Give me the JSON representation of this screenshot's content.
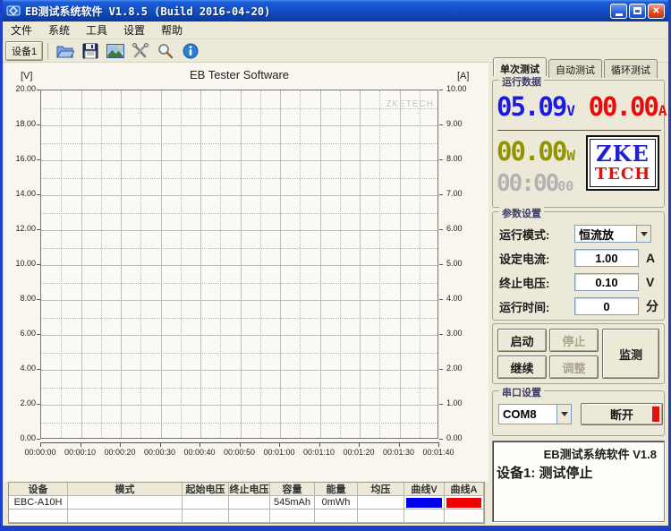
{
  "window": {
    "title": "EB测试系统软件 V1.8.5 (Build 2016-04-20)",
    "icons": [
      "app-icon",
      "minimize-button",
      "maximize-button",
      "close-button"
    ]
  },
  "menu": {
    "items": [
      "文件",
      "系统",
      "工具",
      "设置",
      "帮助"
    ]
  },
  "toolbar": {
    "device_button": "设备1",
    "icons": [
      "open-file-icon",
      "save-icon",
      "image-export-icon",
      "tools-icon",
      "zoom-icon",
      "info-icon"
    ]
  },
  "chart_data": {
    "type": "line",
    "title": "EB Tester Software",
    "watermark": "ZKETECH",
    "left_axis": {
      "label": "[V]",
      "min": 0,
      "max": 20,
      "step": 2,
      "ticks": [
        "20.00",
        "18.00",
        "16.00",
        "14.00",
        "12.00",
        "10.00",
        "8.00",
        "6.00",
        "4.00",
        "2.00",
        "0.00"
      ]
    },
    "right_axis": {
      "label": "[A]",
      "min": 0,
      "max": 10,
      "step": 1,
      "ticks": [
        "10.00",
        "9.00",
        "8.00",
        "7.00",
        "6.00",
        "5.00",
        "4.00",
        "3.00",
        "2.00",
        "1.00",
        "0.00"
      ]
    },
    "x_axis": {
      "ticks": [
        "00:00:00",
        "00:00:10",
        "00:00:20",
        "00:00:30",
        "00:00:40",
        "00:00:50",
        "00:01:00",
        "00:01:10",
        "00:01:20",
        "00:01:30",
        "00:01:40"
      ]
    },
    "grid": "major solid, minor dotted",
    "series": []
  },
  "tabs": [
    {
      "label": "单次测试",
      "active": true
    },
    {
      "label": "自动测试",
      "active": false
    },
    {
      "label": "循环测试",
      "active": false
    }
  ],
  "run_data": {
    "group_label": "运行数据",
    "voltage": {
      "value": "05.09",
      "unit": "V",
      "color": "#1a1ae0"
    },
    "current": {
      "value": "00.00",
      "unit": "A",
      "color": "#e80c0c"
    },
    "power": {
      "value": "00.00",
      "unit": "W",
      "color": "#8f9400"
    },
    "timer": {
      "value": "00:00",
      "seconds": "00",
      "color": "#b2b2b2"
    },
    "logo": {
      "line1": "ZKE",
      "line2": "TECH",
      "color1": "#2222cc",
      "color2": "#dd1111"
    }
  },
  "params": {
    "group_label": "参数设置",
    "rows": [
      {
        "label": "运行模式:",
        "value": "恒流放",
        "unit": "",
        "type": "select"
      },
      {
        "label": "设定电流:",
        "value": "1.00",
        "unit": "A",
        "type": "input"
      },
      {
        "label": "终止电压:",
        "value": "0.10",
        "unit": "V",
        "type": "input"
      },
      {
        "label": "运行时间:",
        "value": "0",
        "unit": "分",
        "type": "input"
      }
    ]
  },
  "controls": {
    "start": "启动",
    "stop": "停止",
    "monitor": "监测",
    "continue": "继续",
    "adjust": "调整",
    "disabled": [
      "停止",
      "调整"
    ]
  },
  "serial": {
    "group_label": "串口设置",
    "port": "COM8",
    "disconnect": "断开",
    "indicator_color": "#e01010"
  },
  "status": {
    "line1": "EB测试系统软件 V1.8",
    "line2": "设备1: 测试停止"
  },
  "table": {
    "headers": [
      "设备",
      "模式",
      "起始电压",
      "终止电压",
      "容量",
      "能量",
      "均压",
      "曲线V",
      "曲线A"
    ],
    "rows": [
      {
        "cells": [
          "EBC-A10H",
          "",
          "",
          "",
          "545mAh",
          "0mWh",
          ""
        ],
        "curveV": "#0000f0",
        "curveA": "#f00000"
      },
      {
        "cells": [
          "",
          "",
          "",
          "",
          "",
          "",
          ""
        ],
        "curveV": "",
        "curveA": ""
      }
    ]
  }
}
